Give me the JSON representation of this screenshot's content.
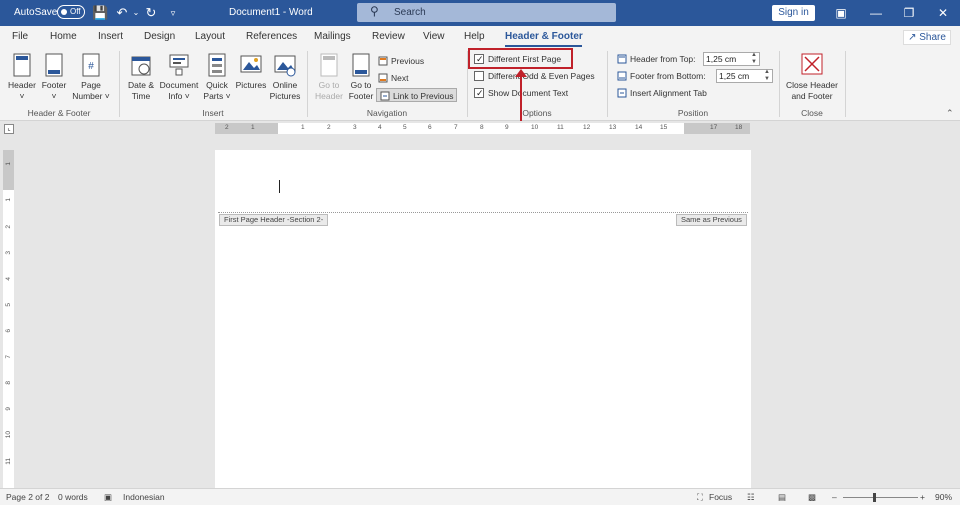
{
  "titlebar": {
    "autosave_label": "AutoSave",
    "autosave_state": "Off",
    "doc_title": "Document1 - Word",
    "search_placeholder": "Search",
    "signin_label": "Sign in"
  },
  "tabs": [
    "File",
    "Home",
    "Insert",
    "Design",
    "Layout",
    "References",
    "Mailings",
    "Review",
    "View",
    "Help",
    "Header & Footer"
  ],
  "share_label": "Share",
  "ribbon": {
    "hf_group": {
      "label": "Header & Footer",
      "header": [
        "Header",
        "˅"
      ],
      "footer": [
        "Footer",
        "˅"
      ],
      "page_number": [
        "Page",
        "Number ˅"
      ]
    },
    "insert_group": {
      "label": "Insert",
      "date_time": [
        "Date &",
        "Time"
      ],
      "doc_info": [
        "Document",
        "Info ˅"
      ],
      "quick_parts": [
        "Quick",
        "Parts ˅"
      ],
      "pictures": [
        "Pictures",
        ""
      ],
      "online_pictures": [
        "Online",
        "Pictures"
      ]
    },
    "nav_group": {
      "label": "Navigation",
      "goto_header": [
        "Go to",
        "Header"
      ],
      "goto_footer": [
        "Go to",
        "Footer"
      ],
      "previous": "Previous",
      "next": "Next",
      "link_prev": "Link to Previous"
    },
    "options_group": {
      "label": "Options",
      "diff_first": "Different First Page",
      "diff_first_checked": true,
      "diff_odd_even": "Different Odd & Even Pages",
      "diff_odd_even_checked": false,
      "show_doc_text": "Show Document Text",
      "show_doc_text_checked": true
    },
    "position_group": {
      "label": "Position",
      "header_top_label": "Header from Top:",
      "header_top_value": "1,25 cm",
      "footer_bottom_label": "Footer from Bottom:",
      "footer_bottom_value": "1,25 cm",
      "align_tab": "Insert Alignment Tab"
    },
    "close_group": {
      "label": "Close",
      "close_btn": [
        "Close Header",
        "and Footer"
      ]
    }
  },
  "ruler_ticks": [
    "2",
    "1",
    "1",
    "1",
    "2",
    "3",
    "4",
    "5",
    "6",
    "7",
    "8",
    "9",
    "10",
    "11",
    "12",
    "13",
    "14",
    "15",
    "17",
    "18"
  ],
  "vruler_ticks": [
    "1",
    "1",
    "2",
    "3",
    "4",
    "5",
    "6",
    "7",
    "8",
    "9",
    "10",
    "11"
  ],
  "page": {
    "header_tag": "First Page Header -Section 2-",
    "same_as_prev": "Same as Previous"
  },
  "status": {
    "page": "Page 2 of 2",
    "words": "0 words",
    "lang": "Indonesian",
    "focus": "Focus",
    "zoom": "90%"
  }
}
